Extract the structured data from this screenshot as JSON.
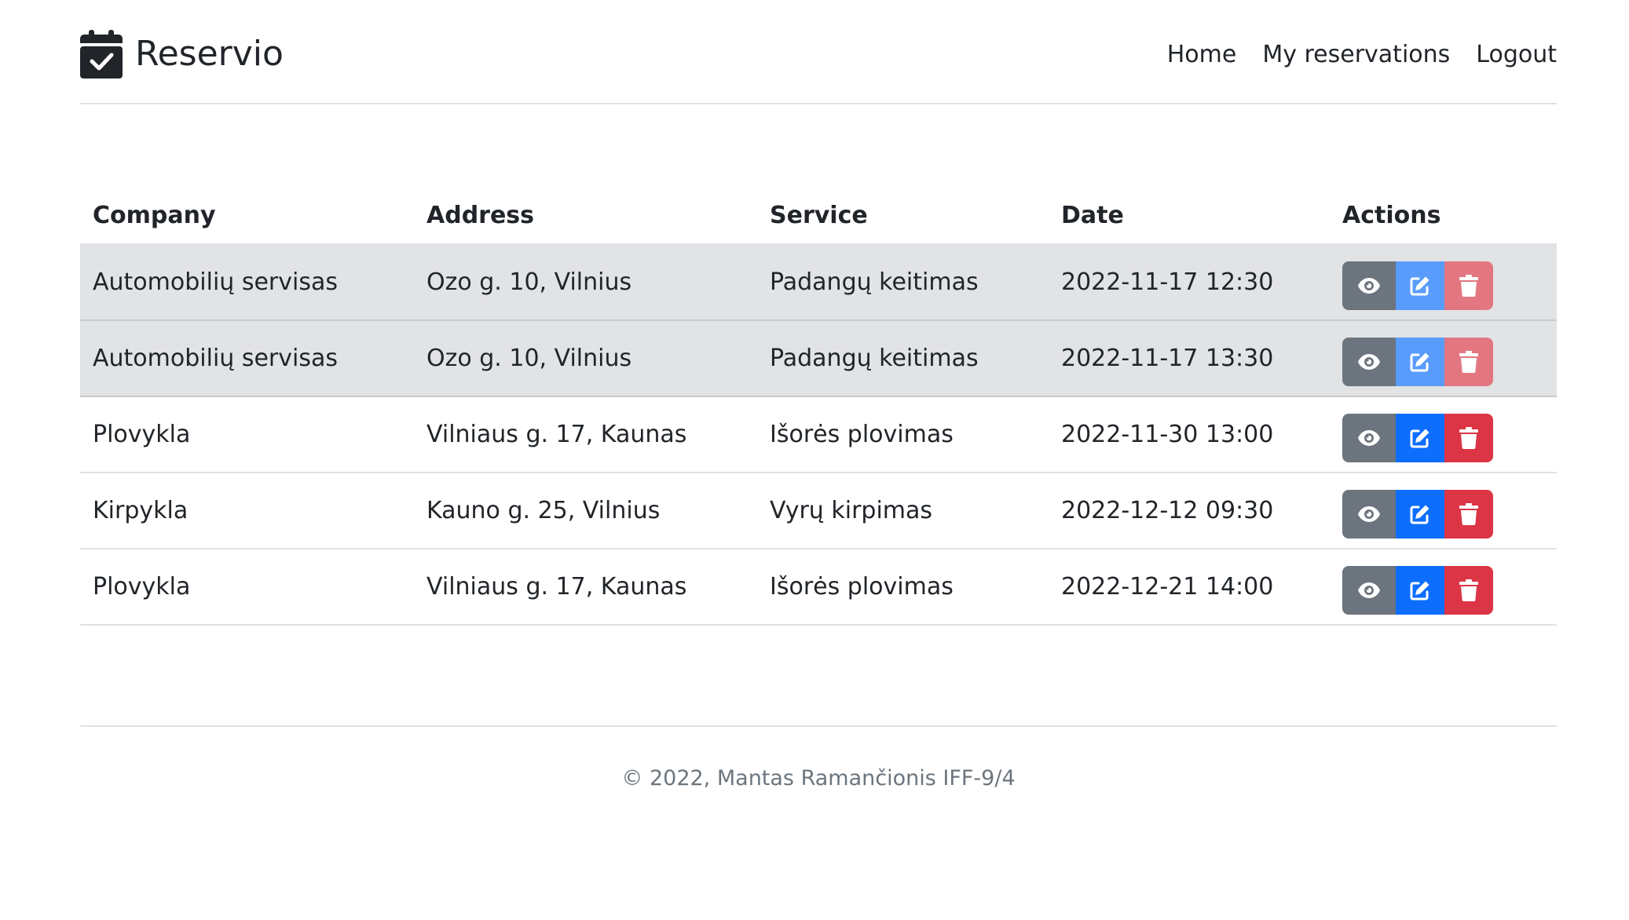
{
  "header": {
    "brand": "Reservio",
    "brand_icon": "calendar-check-icon",
    "nav": [
      "Home",
      "My reservations",
      "Logout"
    ]
  },
  "table": {
    "columns": [
      "Company",
      "Address",
      "Service",
      "Date",
      "Actions"
    ],
    "rows": [
      {
        "company": "Automobilių servisas",
        "address": "Ozo g. 10, Vilnius",
        "service": "Padangų keitimas",
        "date": "2022-11-17 12:30",
        "past": true
      },
      {
        "company": "Automobilių servisas",
        "address": "Ozo g. 10, Vilnius",
        "service": "Padangų keitimas",
        "date": "2022-11-17 13:30",
        "past": true
      },
      {
        "company": "Plovykla",
        "address": "Vilniaus g. 17, Kaunas",
        "service": "Išorės plovimas",
        "date": "2022-11-30 13:00",
        "past": false
      },
      {
        "company": "Kirpykla",
        "address": "Kauno g. 25, Vilnius",
        "service": "Vyrų kirpimas",
        "date": "2022-12-12 09:30",
        "past": false
      },
      {
        "company": "Plovykla",
        "address": "Vilniaus g. 17, Kaunas",
        "service": "Išorės plovimas",
        "date": "2022-12-21 14:00",
        "past": false
      }
    ],
    "action_icons": [
      "eye-icon",
      "edit-icon",
      "trash-icon"
    ]
  },
  "colors": {
    "view": "#6c757d",
    "edit": "#0d6efd",
    "delete": "#dc3545",
    "past_row": "#e2e3e5"
  },
  "footer": {
    "text": "© 2022, Mantas Ramančionis IFF-9/4"
  }
}
